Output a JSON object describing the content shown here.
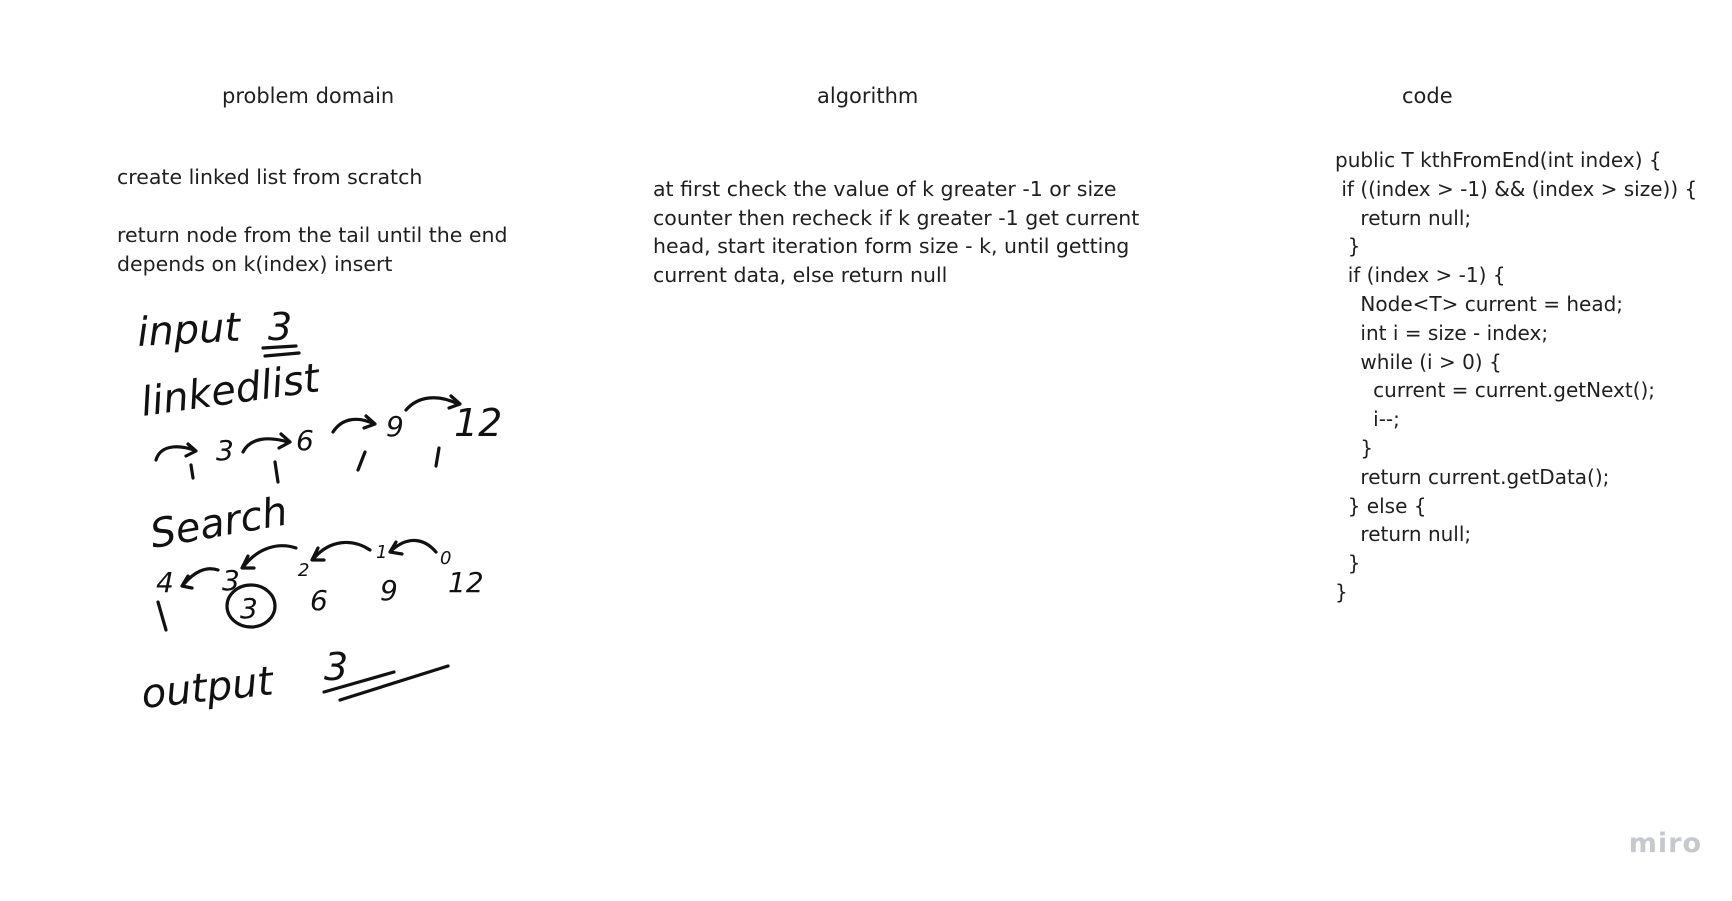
{
  "columns": {
    "problem_domain": {
      "title": "problem domain",
      "paragraph_1": "create linked list from scratch",
      "paragraph_2": "return node from the tail until the end depends on k(index) insert"
    },
    "algorithm": {
      "title": "algorithm",
      "paragraph": "at first check the value of k greater -1 or size counter then recheck if k greater -1 get current head, start iteration form size - k, until getting current data, else return null"
    },
    "code": {
      "title": "code",
      "lines": [
        "public T kthFromEnd(int index) {",
        " if ((index > -1) && (index > size)) {",
        "    return null;",
        "  }",
        "  if (index > -1) {",
        "    Node<T> current = head;",
        "    int i = size - index;",
        "    while (i > 0) {",
        "      current = current.getNext();",
        "      i--;",
        "    }",
        "    return current.getData();",
        "  } else {",
        "    return null;",
        "  }",
        "}"
      ]
    }
  },
  "sketch": {
    "input_label": "input",
    "input_value": "3",
    "list_label": "linkedlist",
    "list_values": [
      "3",
      "6",
      "9",
      "12"
    ],
    "list_indices": [
      "1",
      "1",
      "1",
      "1"
    ],
    "search_label": "Search",
    "search_counts": [
      "4",
      "3",
      "2",
      "1",
      "0"
    ],
    "search_values": [
      "3",
      "6",
      "9",
      "12"
    ],
    "search_first_index": "1",
    "output_label": "output",
    "output_value": "3"
  },
  "watermark": "miro"
}
